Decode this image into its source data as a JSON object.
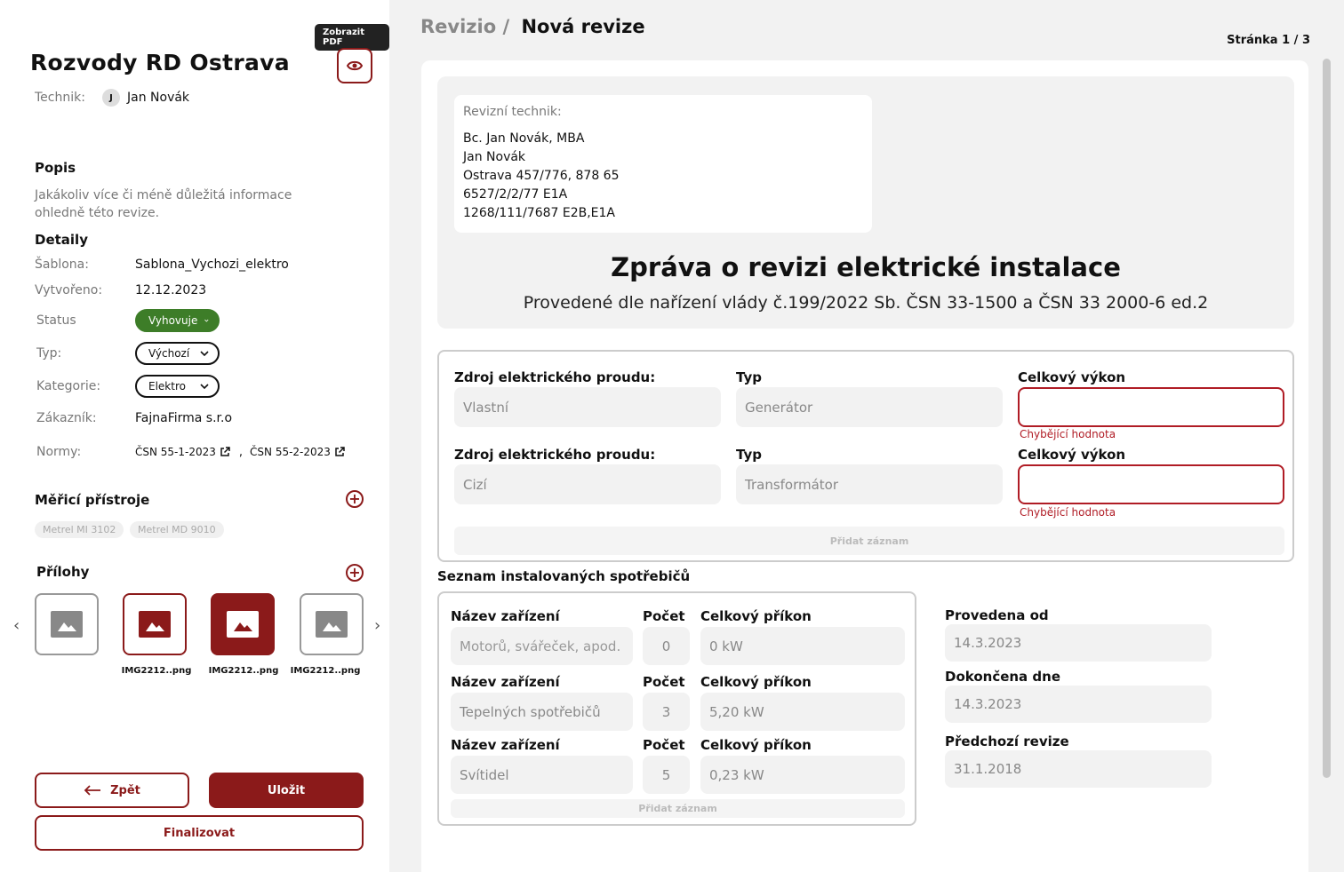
{
  "sidebar": {
    "title": "Rozvody RD Ostrava",
    "tooltip": "Zobrazit PDF",
    "technician_label": "Technik:",
    "technician_initial": "J",
    "technician_name": "Jan Novák",
    "description_title": "Popis",
    "description_text": "Jakákoliv více či méně důležitá informace ohledně této revize.",
    "details_title": "Detaily",
    "details": {
      "template_label": "Šablona:",
      "template_value": "Sablona_Vychozi_elektro",
      "created_label": "Vytvořeno:",
      "created_value": "12.12.2023",
      "status_label": "Status",
      "status_value": "Vyhovuje",
      "type_label": "Typ:",
      "type_value": "Výchozí",
      "category_label": "Kategorie:",
      "category_value": "Elektro",
      "customer_label": "Zákazník:",
      "customer_value": "FajnaFirma s.r.o",
      "norms_label": "Normy:",
      "norms": [
        "ČSN 55-1-2023",
        "ČSN 55-2-2023"
      ],
      "norms_separator": ","
    },
    "instruments_title": "Měřicí přístroje",
    "instruments": [
      "Metrel MI 3102",
      "Metrel MD 9010"
    ],
    "attachments_title": "Přílohy",
    "attachments": [
      "",
      "IMG2212..png",
      "IMG2212..png",
      "IMG2212..png"
    ],
    "back_label": "Zpět",
    "save_label": "Uložit",
    "finalize_label": "Finalizovat"
  },
  "header": {
    "breadcrumb_root": "Revizio /",
    "breadcrumb_current": "Nová revize",
    "page_indicator": "Stránka 1 / 3"
  },
  "report": {
    "tech_card_title": "Revizní technik:",
    "tech_lines": [
      "Bc. Jan Novák, MBA",
      "Jan Novák",
      "Ostrava 457/776, 878 65",
      "6527/2/2/77 E1A",
      "1268/111/7687 E2B,E1A"
    ],
    "title": "Zpráva o revizi elektrické instalace",
    "subtitle": "Provedené dle nařízení vlády č.199/2022 Sb. ČSN 33-1500 a ČSN 33 2000-6 ed.2",
    "sources": [
      {
        "source_label": "Zdroj elektrického proudu:",
        "source_value": "Vlastní",
        "type_label": "Typ",
        "type_value": "Generátor",
        "power_label": "Celkový výkon",
        "power_value": "",
        "error": "Chybějící hodnota"
      },
      {
        "source_label": "Zdroj elektrického proudu:",
        "source_value": "Cizí",
        "type_label": "Typ",
        "type_value": "Transformátor",
        "power_label": "Celkový výkon",
        "power_value": "",
        "error": "Chybějící hodnota"
      }
    ],
    "add_record": "Přidat záznam",
    "appliances_title": "Seznam instalovaných spotřebičů",
    "appliances": [
      {
        "name_label": "Název zařízení",
        "name": "Motorů, svářeček, apod.",
        "count_label": "Počet",
        "count": "0",
        "power_label": "Celkový příkon",
        "power": "0 kW"
      },
      {
        "name_label": "Název zařízení",
        "name": "Tepelných spotřebičů",
        "count_label": "Počet",
        "count": "3",
        "power_label": "Celkový příkon",
        "power": "5,20 kW"
      },
      {
        "name_label": "Název zařízení",
        "name": "Svítidel",
        "count_label": "Počet",
        "count": "5",
        "power_label": "Celkový příkon",
        "power": "0,23 kW"
      }
    ],
    "dates": {
      "from_label": "Provedena od",
      "from_value": "14.3.2023",
      "done_label": "Dokončena dne",
      "done_value": "14.3.2023",
      "prev_label": "Předchozí revize",
      "prev_value": "31.1.2018"
    }
  },
  "colors": {
    "accent": "#8b1a1a",
    "success": "#3d7d28",
    "error": "#b01c25"
  }
}
